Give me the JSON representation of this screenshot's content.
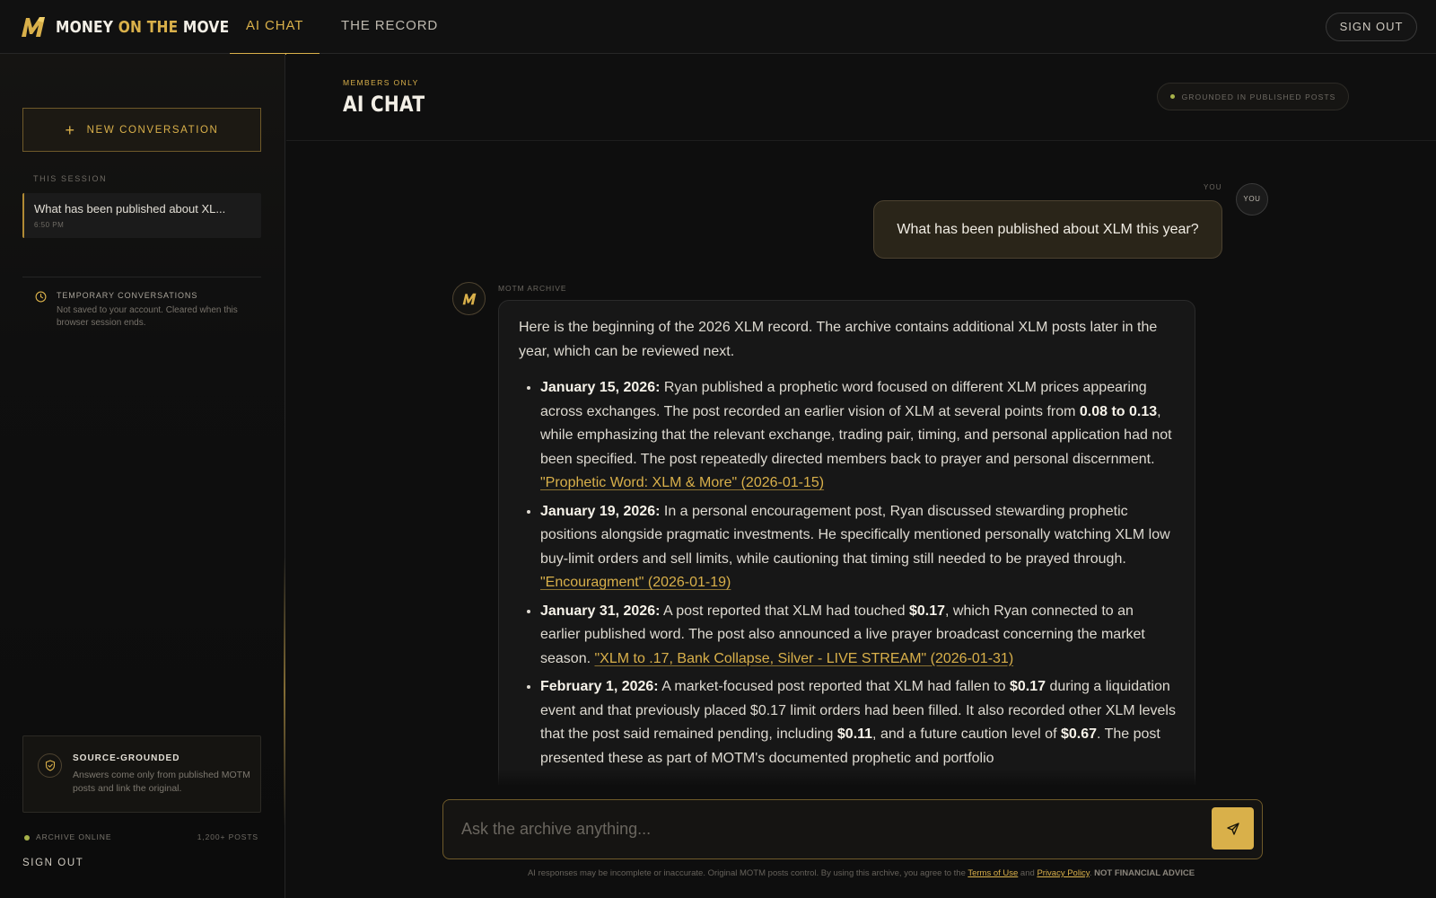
{
  "brand": {
    "name_part1": "MONEY ",
    "name_accent": "ON THE",
    "name_part2": " MOVE",
    "accent_color": "#d9b04a"
  },
  "nav": {
    "tabs": [
      {
        "label": "AI CHAT",
        "active": true
      },
      {
        "label": "THE RECORD",
        "active": false
      }
    ],
    "sign_out": "SIGN OUT"
  },
  "sidebar": {
    "new_conversation": "NEW CONVERSATION",
    "section_label": "THIS SESSION",
    "sessions": [
      {
        "title": "What has been published about XL...",
        "time": "6:50 PM"
      }
    ],
    "temporary": {
      "title": "TEMPORARY CONVERSATIONS",
      "text": "Not saved to your account. Cleared when this browser session ends."
    },
    "source_card": {
      "title": "SOURCE-GROUNDED",
      "text": "Answers come only from published MOTM posts and link the original."
    },
    "status": {
      "label": "ARCHIVE ONLINE",
      "count": "1,200+ POSTS"
    },
    "sign_out": "SIGN OUT"
  },
  "main": {
    "eyebrow": "MEMBERS ONLY",
    "title": "AI CHAT",
    "grounded_badge": "GROUNDED IN PUBLISHED POSTS"
  },
  "chat": {
    "user": {
      "label": "YOU",
      "avatar": "YOU",
      "message": "What has been published about XLM this year?"
    },
    "bot": {
      "label": "MOTM ARCHIVE",
      "intro": "Here is the beginning of the 2026 XLM record. The archive contains additional XLM posts later in the year, which can be reviewed next.",
      "items": [
        {
          "date": "January 15, 2026:",
          "t1": " Ryan published a prophetic word focused on different XLM prices appearing across exchanges. The post recorded an earlier vision of XLM at several points from ",
          "b1": "0.08 to 0.13",
          "t2": ", while emphasizing that the relevant exchange, trading pair, timing, and personal application had not been specified. The post repeatedly directed members back to prayer and personal discernment. ",
          "link": "\"Prophetic Word: XLM & More\" (2026-01-15)"
        },
        {
          "date": "January 19, 2026:",
          "t1": " In a personal encouragement post, Ryan discussed stewarding prophetic positions alongside pragmatic investments. He specifically mentioned personally watching XLM low buy-limit orders and sell limits, while cautioning that timing still needed to be prayed through. ",
          "link": "\"Encouragment\" (2026-01-19)"
        },
        {
          "date": "January 31, 2026:",
          "t1": " A post reported that XLM had touched ",
          "b1": "$0.17",
          "t2": ", which Ryan connected to an earlier published word. The post also announced a live prayer broadcast concerning the market season. ",
          "link": "\"XLM to .17, Bank Collapse, Silver - LIVE STREAM\" (2026-01-31)"
        },
        {
          "date": "February 1, 2026:",
          "t1": " A market-focused post reported that XLM had fallen to ",
          "b1": "$0.17",
          "t2": " during a liquidation event and that previously placed $0.17 limit orders had been filled. It also recorded other XLM levels that the post said remained pending, including ",
          "b2": "$0.11",
          "t3": ", and a future caution level of ",
          "b3": "$0.67",
          "t4": ". The post presented these as part of MOTM's documented prophetic and portfolio"
        }
      ]
    }
  },
  "composer": {
    "placeholder": "Ask the archive anything..."
  },
  "footer": {
    "text1": "AI responses may be incomplete or inaccurate. Original MOTM posts control. By using this archive, you agree to the ",
    "terms": "Terms of Use",
    "and": " and ",
    "privacy": "Privacy Policy",
    "dot": ". ",
    "nfa": "NOT FINANCIAL ADVICE"
  }
}
